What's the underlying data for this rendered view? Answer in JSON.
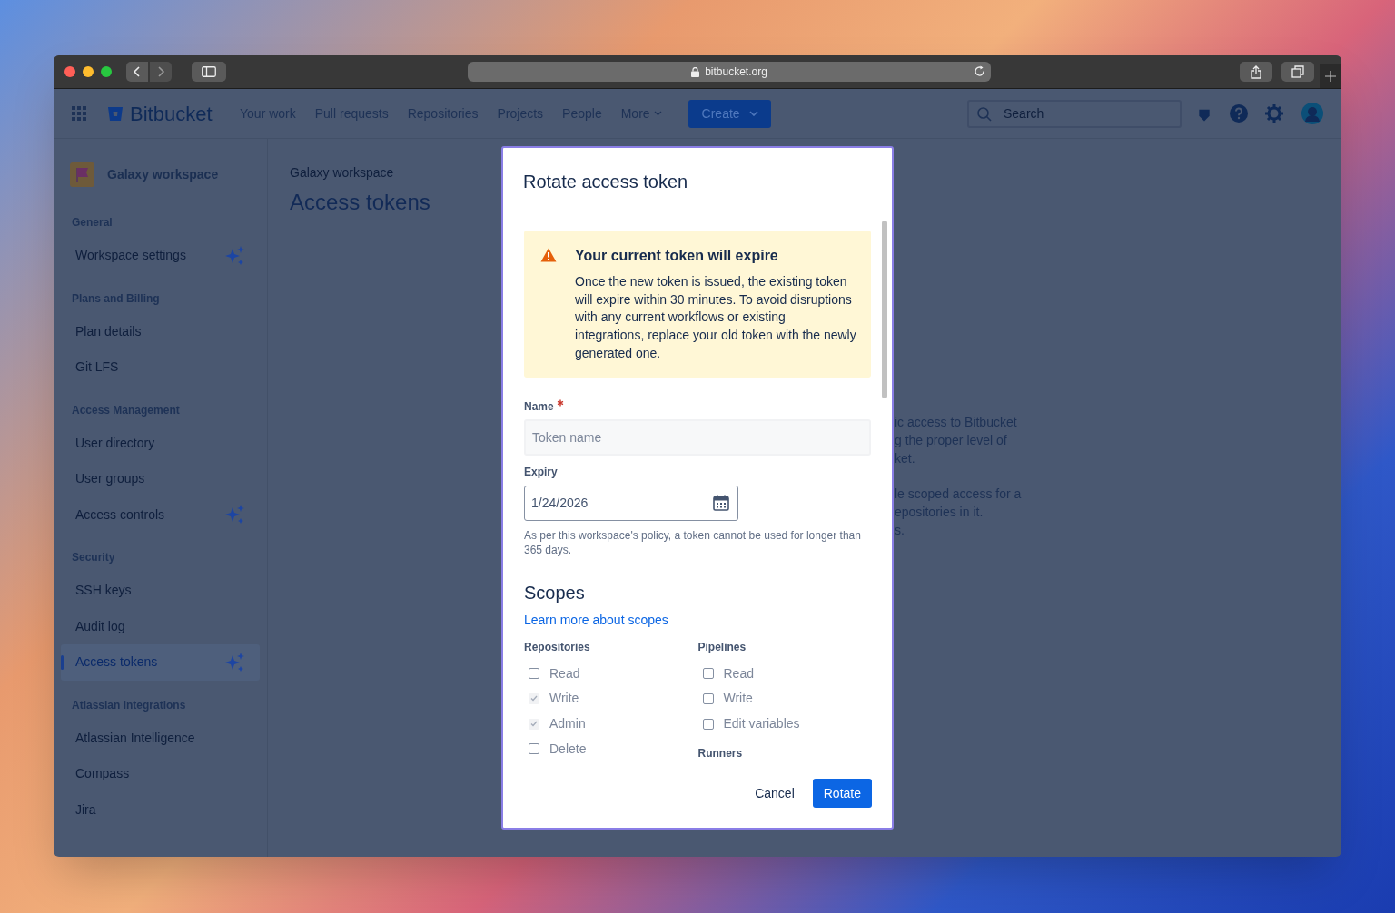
{
  "browser": {
    "url": "bitbucket.org"
  },
  "app_header": {
    "product": "Bitbucket",
    "nav": [
      {
        "label": "Your work",
        "kind": "link"
      },
      {
        "label": "Pull requests",
        "kind": "link"
      },
      {
        "label": "Repositories",
        "kind": "link"
      },
      {
        "label": "Projects",
        "kind": "link"
      },
      {
        "label": "People",
        "kind": "link"
      },
      {
        "label": "More",
        "kind": "dropdown"
      }
    ],
    "create_button": "Create",
    "search": {
      "placeholder": "Search"
    }
  },
  "sidebar": {
    "workspace": "Galaxy workspace",
    "sections": [
      {
        "heading": "General",
        "items": [
          {
            "label": "Workspace settings",
            "ai": true,
            "selected": false
          }
        ]
      },
      {
        "heading": "Plans and Billing",
        "items": [
          {
            "label": "Plan details",
            "ai": false,
            "selected": false
          },
          {
            "label": "Git LFS",
            "ai": false,
            "selected": false
          }
        ]
      },
      {
        "heading": "Access Management",
        "items": [
          {
            "label": "User directory",
            "ai": false,
            "selected": false
          },
          {
            "label": "User groups",
            "ai": false,
            "selected": false
          },
          {
            "label": "Access controls",
            "ai": true,
            "selected": false
          }
        ]
      },
      {
        "heading": "Security",
        "items": [
          {
            "label": "SSH keys",
            "ai": false,
            "selected": false
          },
          {
            "label": "Audit log",
            "ai": false,
            "selected": false
          },
          {
            "label": "Access tokens",
            "ai": true,
            "selected": true
          }
        ]
      },
      {
        "heading": "Atlassian integrations",
        "items": [
          {
            "label": "Atlassian Intelligence",
            "ai": false,
            "selected": false
          },
          {
            "label": "Compass",
            "ai": false,
            "selected": false
          },
          {
            "label": "Jira",
            "ai": false,
            "selected": false
          }
        ]
      }
    ]
  },
  "page": {
    "breadcrumb": "Galaxy workspace",
    "title": "Access tokens",
    "background_text": [
      [
        "ic access to Bitbucket",
        "g the proper level of",
        "ket."
      ],
      [
        "le scoped access for a",
        "epositories in it.",
        "s."
      ]
    ]
  },
  "modal": {
    "title": "Rotate access token",
    "warning": {
      "title": "Your current token will expire",
      "body": "Once the new token is issued, the existing token will expire within 30 minutes. To avoid disruptions with any current workflows or existing integrations, replace your old token with the newly generated one."
    },
    "name_field": {
      "label": "Name",
      "required": true,
      "placeholder": "Token name"
    },
    "expiry_field": {
      "label": "Expiry",
      "value": "1/24/2026",
      "help": "As per this workspace's policy, a token cannot be used for longer than 365 days."
    },
    "scopes": {
      "heading": "Scopes",
      "link": "Learn more about scopes",
      "columns": [
        {
          "groups": [
            {
              "heading": "Repositories",
              "options": [
                {
                  "label": "Read",
                  "checked": false,
                  "disabled": true
                },
                {
                  "label": "Write",
                  "checked": true,
                  "disabled": true
                },
                {
                  "label": "Admin",
                  "checked": true,
                  "disabled": true
                },
                {
                  "label": "Delete",
                  "checked": false,
                  "disabled": true
                }
              ]
            }
          ]
        },
        {
          "groups": [
            {
              "heading": "Pipelines",
              "options": [
                {
                  "label": "Read",
                  "checked": false,
                  "disabled": true
                },
                {
                  "label": "Write",
                  "checked": false,
                  "disabled": true
                },
                {
                  "label": "Edit variables",
                  "checked": false,
                  "disabled": true
                }
              ]
            },
            {
              "heading": "Runners"
            }
          ]
        }
      ]
    },
    "buttons": [
      {
        "label": "Cancel",
        "kind": "subtle"
      },
      {
        "label": "Rotate",
        "kind": "primary"
      }
    ]
  }
}
